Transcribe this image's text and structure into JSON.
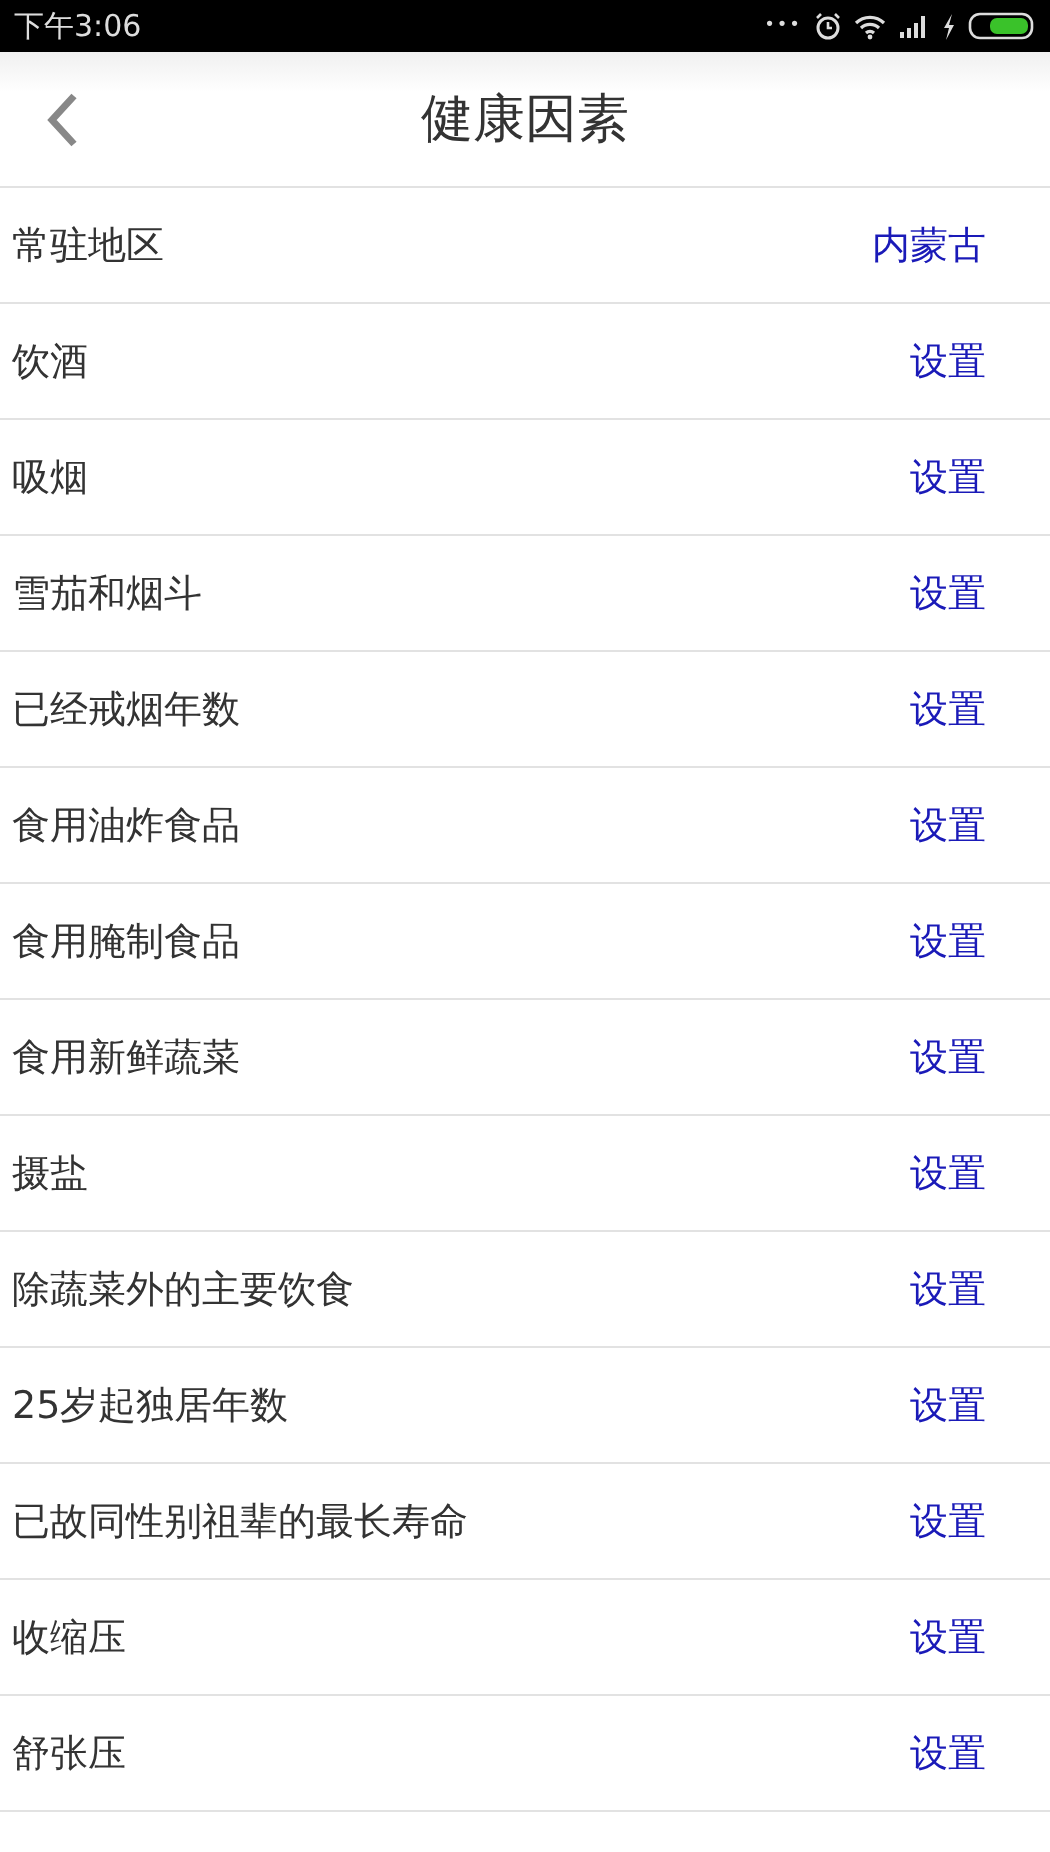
{
  "status_bar": {
    "time": "下午3:06",
    "dots": "•••"
  },
  "header": {
    "title": "健康因素"
  },
  "rows": [
    {
      "label": "常驻地区",
      "value": "内蒙古"
    },
    {
      "label": "饮酒",
      "value": "设置"
    },
    {
      "label": "吸烟",
      "value": "设置"
    },
    {
      "label": "雪茄和烟斗",
      "value": "设置"
    },
    {
      "label": "已经戒烟年数",
      "value": "设置"
    },
    {
      "label": "食用油炸食品",
      "value": "设置"
    },
    {
      "label": "食用腌制食品",
      "value": "设置"
    },
    {
      "label": "食用新鲜蔬菜",
      "value": "设置"
    },
    {
      "label": "摄盐",
      "value": "设置"
    },
    {
      "label": "除蔬菜外的主要饮食",
      "value": "设置"
    },
    {
      "label": "25岁起独居年数",
      "value": "设置"
    },
    {
      "label": "已故同性别祖辈的最长寿命",
      "value": "设置"
    },
    {
      "label": "收缩压",
      "value": "设置"
    },
    {
      "label": "舒张压",
      "value": "设置"
    }
  ]
}
